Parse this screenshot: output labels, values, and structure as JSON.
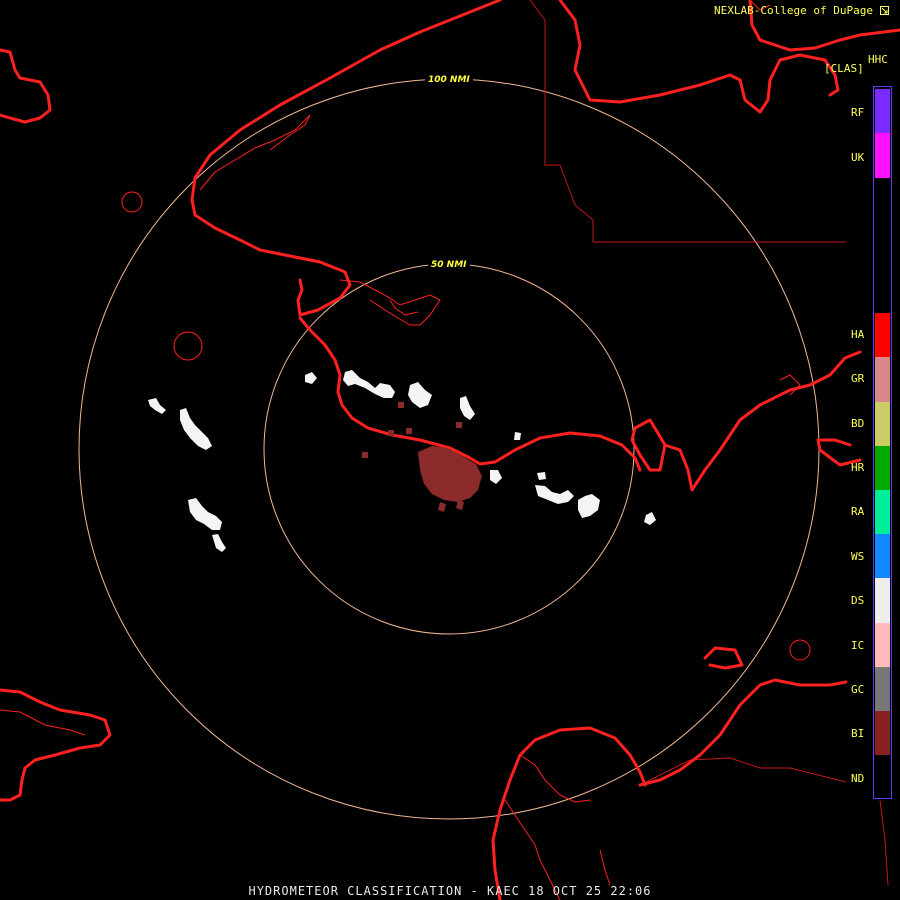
{
  "header": {
    "credit": "NEXLAB-College of DuPage",
    "mode": "HHC",
    "product": "[CLAS]"
  },
  "rings": {
    "outer_label": "100 NMI",
    "inner_label": "50 NMI"
  },
  "legend": {
    "items": [
      {
        "code": "RF",
        "color": "#7b2bff"
      },
      {
        "code": "UK",
        "color": "#ff10ff"
      },
      {
        "code": "HA",
        "color": "#ff0000"
      },
      {
        "code": "GR",
        "color": "#d88888"
      },
      {
        "code": "BD",
        "color": "#cccc66"
      },
      {
        "code": "HR",
        "color": "#00aa00"
      },
      {
        "code": "RA",
        "color": "#00ee99"
      },
      {
        "code": "WS",
        "color": "#1188ff"
      },
      {
        "code": "DS",
        "color": "#eeeeee"
      },
      {
        "code": "IC",
        "color": "#ffbbbb"
      },
      {
        "code": "GC",
        "color": "#777777"
      },
      {
        "code": "BI",
        "color": "#882222"
      },
      {
        "code": "ND",
        "color": "#000000"
      }
    ]
  },
  "footer": {
    "title": "HYDROMETEOR CLASSIFICATION - KAEC 18 OCT 25 22:06"
  },
  "colors": {
    "coast": "#ff2020",
    "rings": "#f2b894",
    "echo_ds": "#f4f4f4",
    "echo_bi": "#8a2a2a"
  }
}
